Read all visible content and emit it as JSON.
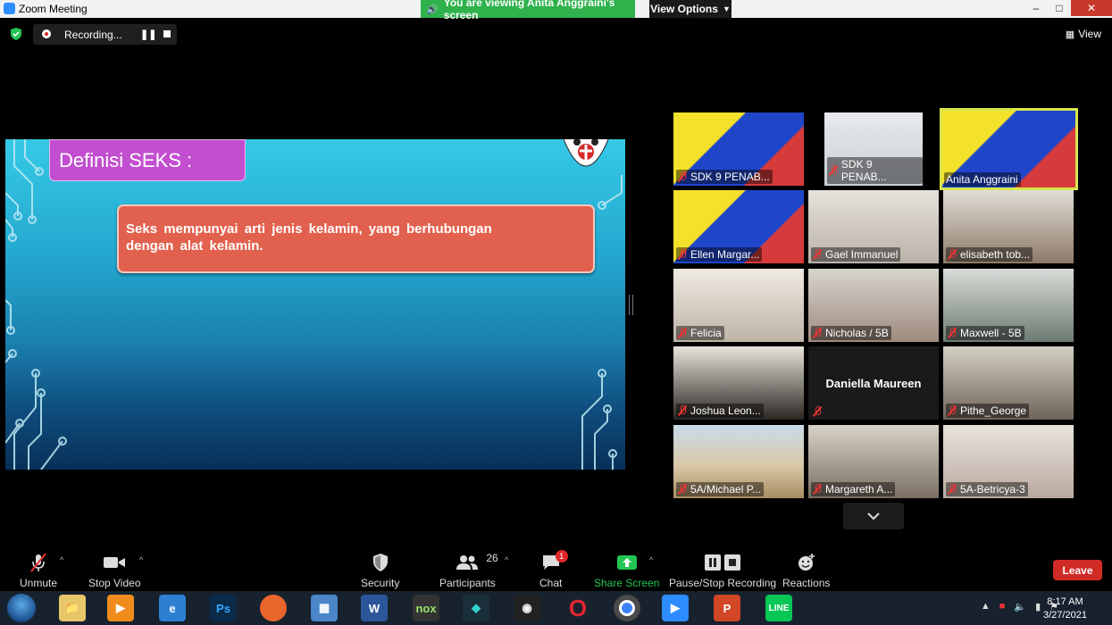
{
  "window": {
    "title": "Zoom Meeting",
    "share_banner": "You are viewing Anita Anggraini's screen",
    "view_options": "View Options"
  },
  "recording": {
    "label": "Recording..."
  },
  "view_button": "View",
  "slide": {
    "title": "Definisi SEKS :",
    "definition_line1": "Seks  mempunyai  arti  jenis kelamin,  yang berhubungan",
    "definition_line2": "dengan  alat  kelamin."
  },
  "participants_gallery": [
    {
      "name": "SDK 9 PENAB...",
      "muted": true
    },
    {
      "name": "SDK 9 PENAB...",
      "muted": true
    },
    {
      "name": "Anita Anggraini",
      "muted": false,
      "active_speaker": true
    },
    {
      "name": "Ellen Margar...",
      "muted": true
    },
    {
      "name": "Gael Immanuel",
      "muted": true
    },
    {
      "name": "elisabeth tob...",
      "muted": true
    },
    {
      "name": "Felicia",
      "muted": true
    },
    {
      "name": "Nicholas / 5B",
      "muted": true
    },
    {
      "name": "Maxwell - 5B",
      "muted": true
    },
    {
      "name": "Joshua Leon...",
      "muted": true
    },
    {
      "name": "Daniella Maureen",
      "muted": true,
      "video_off": true
    },
    {
      "name": "Pithe_George",
      "muted": true
    },
    {
      "name": "5A/Michael P...",
      "muted": true
    },
    {
      "name": "Margareth A...",
      "muted": true
    },
    {
      "name": "5A-Betricya-3",
      "muted": true
    }
  ],
  "toolbar": {
    "unmute": "Unmute",
    "stop_video": "Stop Video",
    "security": "Security",
    "participants": "Participants",
    "participants_count": "26",
    "chat": "Chat",
    "chat_badge": "1",
    "share_screen": "Share Screen",
    "pause_stop_recording": "Pause/Stop Recording",
    "reactions": "Reactions",
    "leave": "Leave"
  },
  "taskbar": {
    "time": "8:17 AM",
    "date": "3/27/2021",
    "apps": [
      "file-explorer",
      "media-player",
      "internet-explorer",
      "photoshop",
      "firefox",
      "control-panel",
      "word",
      "nox",
      "filmora",
      "camera",
      "opera",
      "chrome",
      "zoom",
      "powerpoint",
      "line"
    ]
  },
  "colors": {
    "share_banner": "#2fb24c",
    "leave": "#d12b26",
    "share_screen_icon": "#23c552",
    "active_speaker_border": "#d7e64b",
    "slide_title_box": "#c24fcf",
    "definition_box": "#e2614e"
  }
}
